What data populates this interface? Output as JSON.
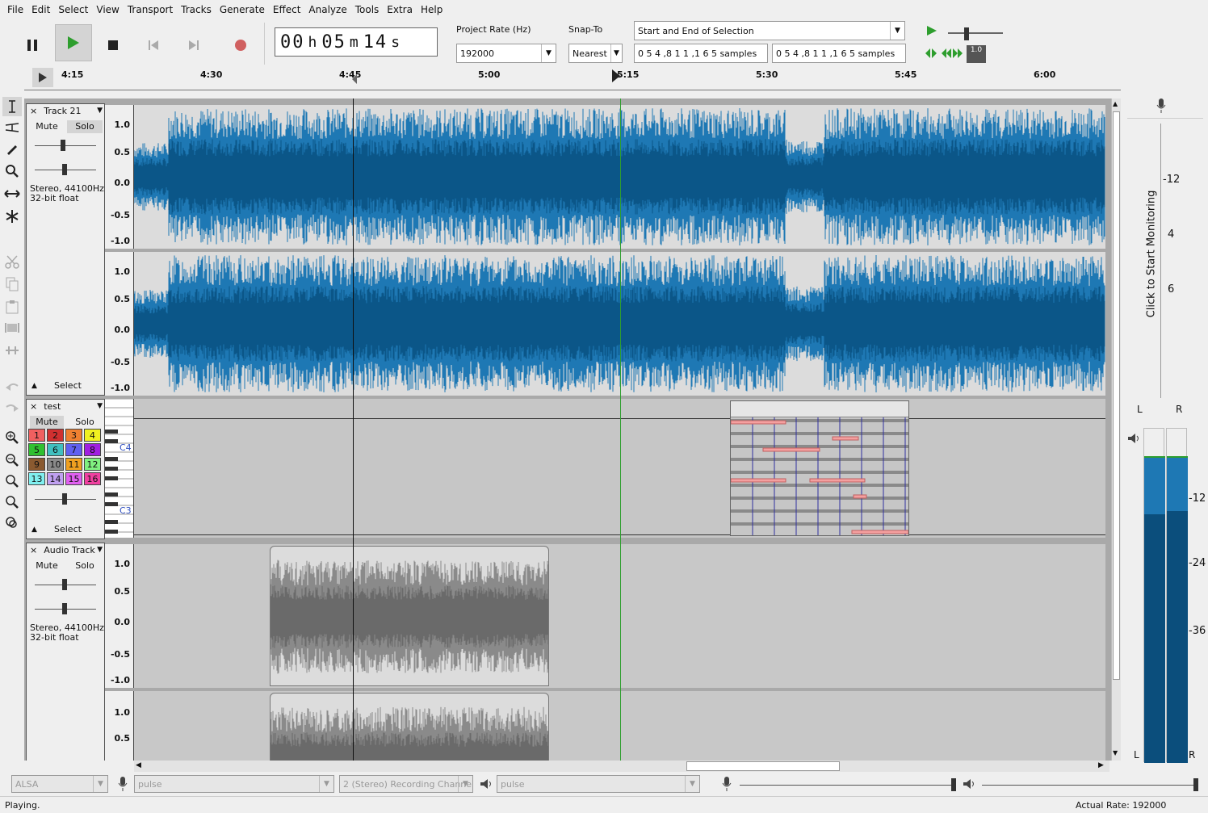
{
  "menu": [
    "File",
    "Edit",
    "Select",
    "View",
    "Transport",
    "Tracks",
    "Generate",
    "Effect",
    "Analyze",
    "Tools",
    "Extra",
    "Help"
  ],
  "time_display": {
    "h": "00",
    "h_unit": "h",
    "m": "05",
    "m_unit": "m",
    "s": "14",
    "s_unit": "s"
  },
  "project_rate": {
    "label": "Project Rate (Hz)",
    "value": "192000"
  },
  "snap": {
    "label": "Snap-To",
    "value": "Nearest"
  },
  "selection": {
    "mode": "Start and End of Selection",
    "start": "0 5 4 ,8 1 1 ,1 6 5  samples",
    "end": "0 5 4 ,8 1 1 ,1 6 5  samples"
  },
  "playspeed": {
    "value": "1.0"
  },
  "ruler_labels": [
    "4:15",
    "4:30",
    "4:45",
    "5:00",
    "5:15",
    "5:30",
    "5:45",
    "6:00"
  ],
  "tracks": [
    {
      "name": "Track 21",
      "mute": "Mute",
      "solo": "Solo",
      "info1": "Stereo, 44100Hz",
      "info2": "32-bit float",
      "select": "Select",
      "scale": [
        "1.0",
        "0.5",
        "0.0",
        "-0.5",
        "-1.0"
      ]
    },
    {
      "name": "test",
      "mute": "Mute",
      "solo": "Solo",
      "select": "Select",
      "keys": [
        "C4",
        "C3"
      ],
      "channels": [
        "1",
        "2",
        "3",
        "4",
        "5",
        "6",
        "7",
        "8",
        "9",
        "10",
        "11",
        "12",
        "13",
        "14",
        "15",
        "16"
      ]
    },
    {
      "name": "Audio Track",
      "mute": "Mute",
      "solo": "Solo",
      "info1": "Stereo, 44100Hz",
      "info2": "32-bit float",
      "scale": [
        "1.0",
        "0.5",
        "0.0",
        "-0.5",
        "-1.0"
      ],
      "scale2": [
        "1.0",
        "0.5"
      ]
    }
  ],
  "meter": {
    "monitor": "Click to Start Monitoring",
    "rec_scale": [
      "-12",
      "4",
      "6"
    ],
    "play_scale": [
      "-12",
      "-24",
      "-36"
    ],
    "L": "L",
    "R": "R"
  },
  "devices": {
    "host": "ALSA",
    "rec": "pulse",
    "channels": "2 (Stereo) Recording Channe",
    "play": "pulse"
  },
  "status": {
    "left": "Playing.",
    "right": "Actual Rate: 192000"
  },
  "colors": {
    "wave": "#1e78b4",
    "wave_dark": "#0b5688",
    "selected_bg": "#dcdcdc",
    "unselected_bg": "#c8c8c8",
    "gray_wave": "#8a8a8a",
    "gray_wave_dark": "#6a6a6a",
    "note": "#f4a0a0",
    "play_green": "#2e9e2e",
    "record": "#d05050"
  }
}
